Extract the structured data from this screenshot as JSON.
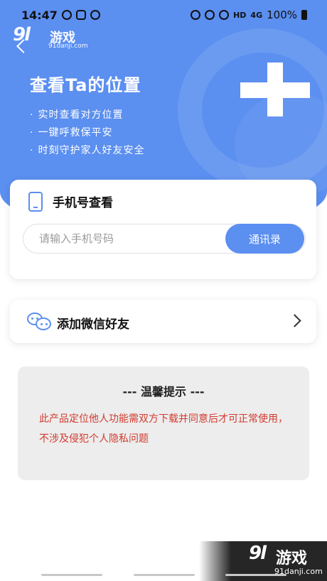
{
  "status_bar": {
    "time": "14:47",
    "network": "HD",
    "network_gen": "4G",
    "battery": "100%"
  },
  "watermark": {
    "logo": "9l",
    "name": "游戏",
    "url": "91danji.com"
  },
  "hero": {
    "title": "查看Ta的位置",
    "features": [
      "实时查看对方位置",
      "一键呼救保平安",
      "时刻守护家人好友安全"
    ],
    "plus_icon": "plus-icon"
  },
  "phone_lookup": {
    "title": "手机号查看",
    "input_placeholder": "请输入手机号码",
    "input_value": "",
    "contacts_button": "通讯录"
  },
  "wechat": {
    "title": "添加微信好友"
  },
  "tips": {
    "title": "--- 温馨提示 ---",
    "text": "此产品定位他人功能需双方下载并同意后才可正常使用，不涉及侵犯个人隐私问题"
  },
  "colors": {
    "primary": "#5b8ff0",
    "warning_text": "#d23a2e",
    "tips_bg": "#ededed"
  }
}
